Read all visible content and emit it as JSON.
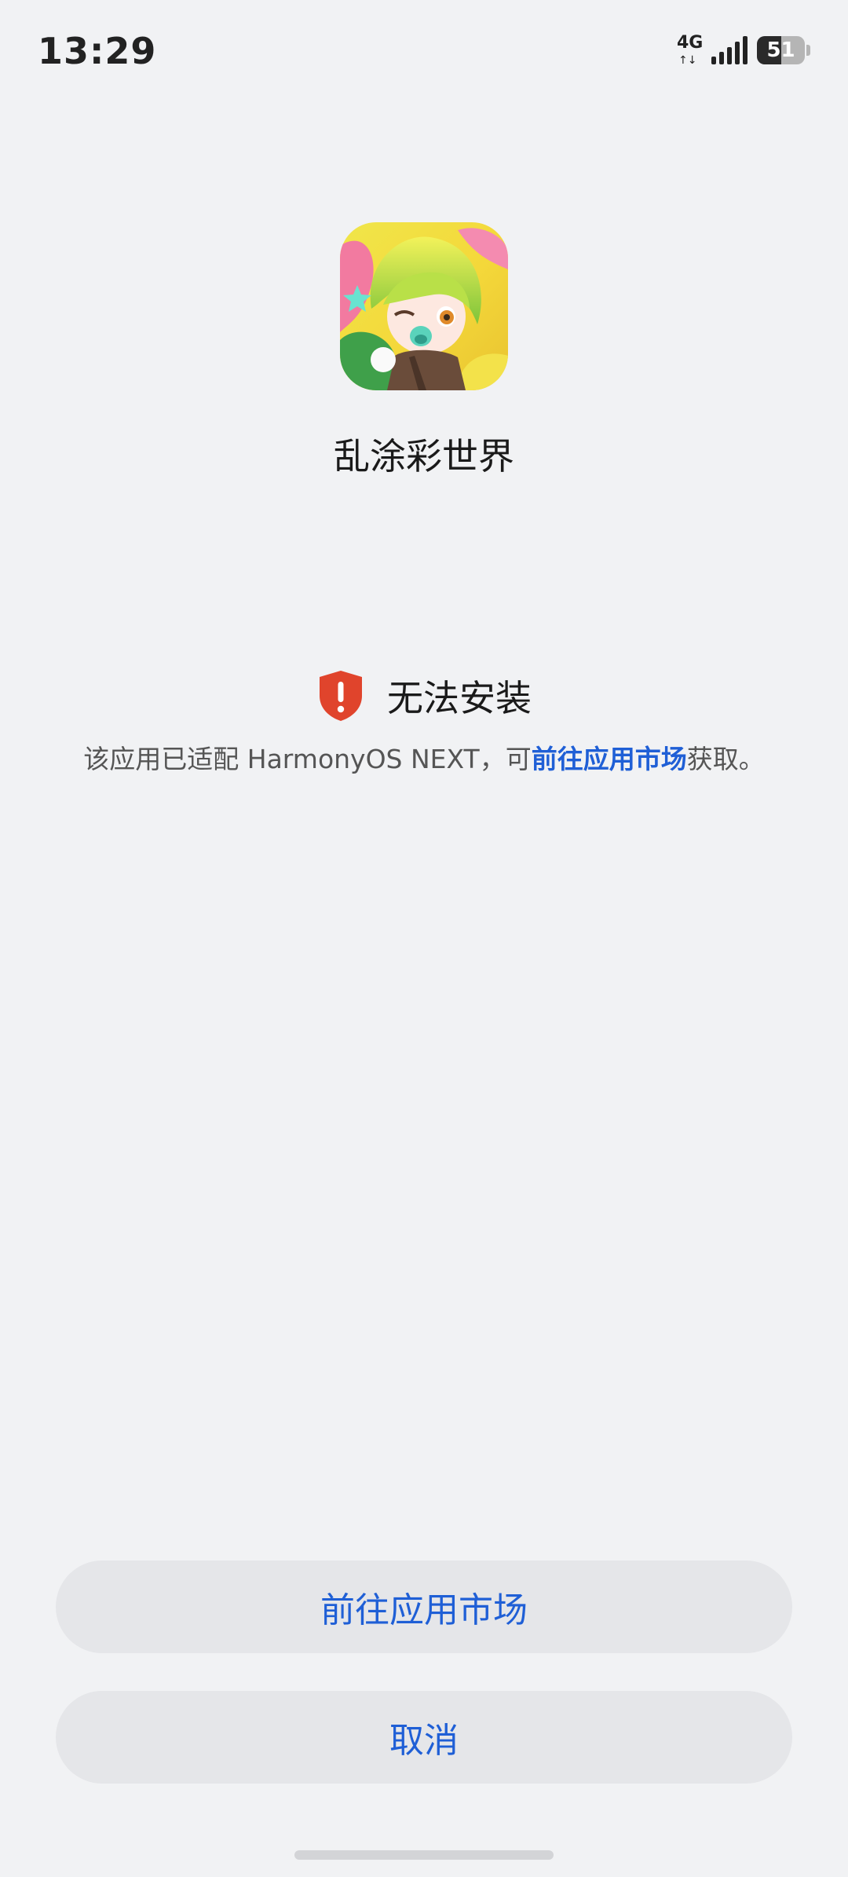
{
  "status_bar": {
    "time": "13:29",
    "network": "4G",
    "network_arrows": "↑↓",
    "battery_level": "51",
    "battery_fraction": 0.51,
    "signal_bars": 5
  },
  "app": {
    "name": "乱涂彩世界",
    "icon": "app-character-icon"
  },
  "error": {
    "title": "无法安装",
    "icon": "shield-warning-icon",
    "desc_prefix": "该应用已适配 HarmonyOS NEXT，可",
    "desc_link": "前往应用市场",
    "desc_suffix": "获取。"
  },
  "buttons": {
    "go_market": "前往应用市场",
    "cancel": "取消"
  },
  "colors": {
    "accent": "#1f5fd6",
    "warning": "#e0442c",
    "background": "#f1f2f4",
    "button_bg": "#e5e6e9"
  }
}
